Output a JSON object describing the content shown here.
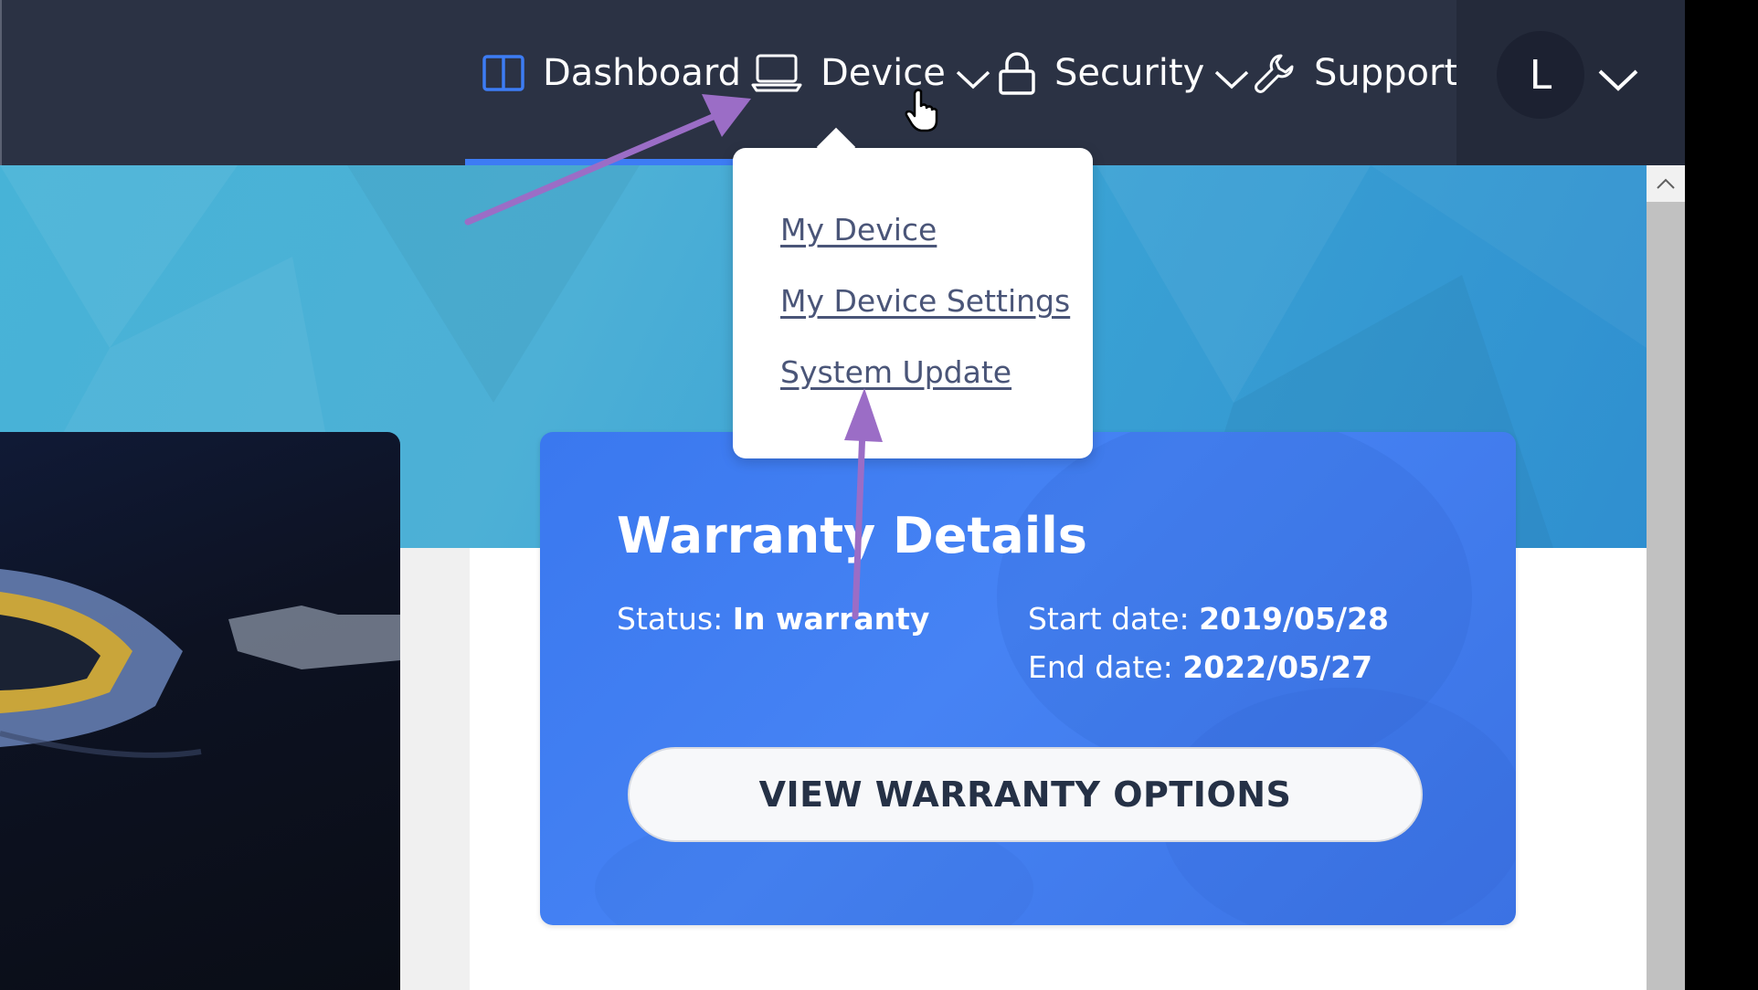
{
  "nav": {
    "dashboard_label": "Dashboard",
    "device_label": "Device",
    "security_label": "Security",
    "support_label": "Support",
    "user_initial": "L",
    "icons": [
      "dashboard-icon",
      "laptop-icon",
      "lock-icon",
      "wrench-icon",
      "chevron-down-icon"
    ]
  },
  "device_menu": {
    "items": [
      "My Device",
      "My Device Settings",
      "System Update"
    ]
  },
  "warranty": {
    "title": "Warranty Details",
    "status_label": "Status:",
    "status_value": "In warranty",
    "start_label": "Start date:",
    "start_value": "2019/05/28",
    "end_label": "End date:",
    "end_value": "2022/05/27",
    "button_label": "VIEW WARRANTY OPTIONS"
  },
  "colors": {
    "header_bg": "#2b3244",
    "accent_blue": "#3d7cf4",
    "card_blue": "#4683f4",
    "annotation_purple": "#9b6dc6",
    "link_color": "#4a5578"
  }
}
